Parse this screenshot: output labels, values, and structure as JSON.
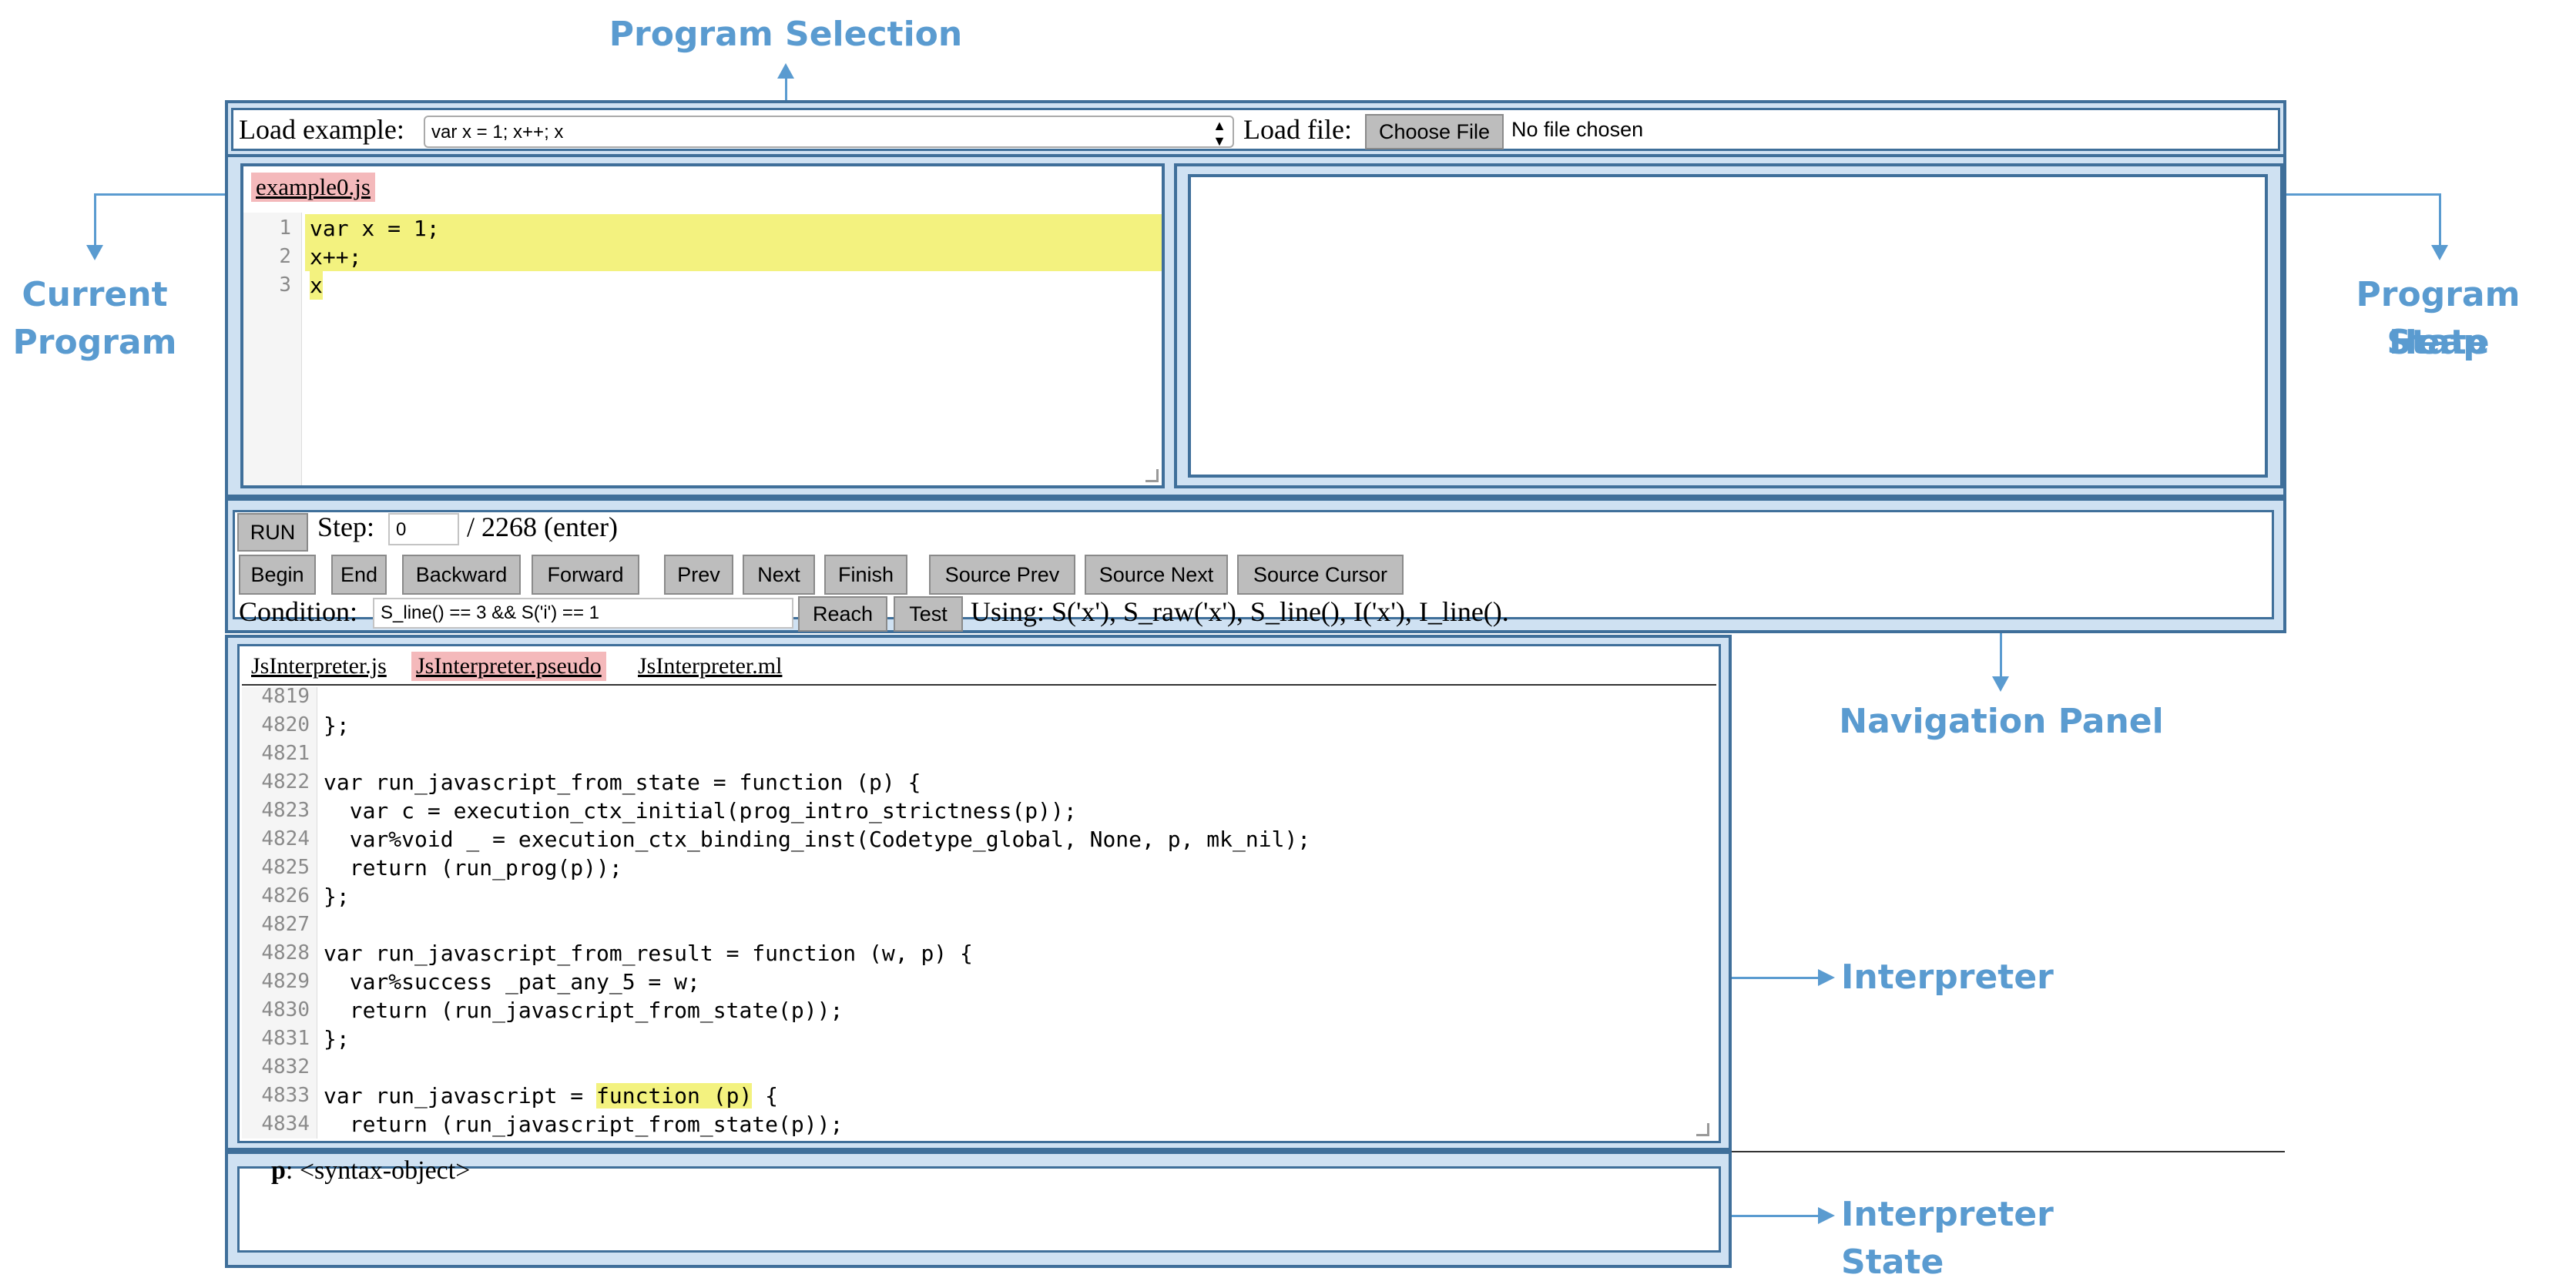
{
  "callouts": {
    "program_selection": "Program Selection",
    "current_program": [
      "Current",
      "Program"
    ],
    "program_heap_state": [
      "Program Heap",
      "State"
    ],
    "navigation_panel": "Navigation Panel",
    "interpreter": "Interpreter",
    "interpreter_state": "Interpreter State"
  },
  "selection": {
    "load_example_label": "Load example:",
    "example_value": "var x = 1; x++; x",
    "load_file_label": "Load file:",
    "choose_file_button": "Choose File",
    "no_file_text": "No file chosen"
  },
  "editor": {
    "tab": "example0.js",
    "lines": [
      {
        "n": "1",
        "text": "var x = 1;"
      },
      {
        "n": "2",
        "text": "x++;"
      },
      {
        "n": "3",
        "text": "x"
      }
    ]
  },
  "navigation": {
    "run_button": "RUN",
    "step_label": "Step:",
    "step_value": "0",
    "step_total": "/ 2268 (enter)",
    "buttons": {
      "begin": "Begin",
      "end": "End",
      "backward": "Backward",
      "forward": "Forward",
      "prev": "Prev",
      "next": "Next",
      "finish": "Finish",
      "source_prev": "Source Prev",
      "source_next": "Source Next",
      "source_cursor": "Source Cursor"
    },
    "condition_label": "Condition:",
    "condition_value": "S_line() == 3 && S('i') == 1",
    "reach_button": "Reach",
    "test_button": "Test",
    "using_text": "Using: S('x'), S_raw('x'), S_line(), I('x'), I_line()."
  },
  "interpreter": {
    "tabs": [
      "JsInterpreter.js",
      "JsInterpreter.pseudo",
      "JsInterpreter.ml"
    ],
    "active_tab": "JsInterpreter.pseudo",
    "lines": [
      {
        "n": "4819",
        "text": ""
      },
      {
        "n": "4820",
        "text": "};"
      },
      {
        "n": "4821",
        "text": ""
      },
      {
        "n": "4822",
        "text": "var run_javascript_from_state = function (p) {"
      },
      {
        "n": "4823",
        "text": "  var c = execution_ctx_initial(prog_intro_strictness(p));"
      },
      {
        "n": "4824",
        "text": "  var%void _ = execution_ctx_binding_inst(Codetype_global, None, p, mk_nil);"
      },
      {
        "n": "4825",
        "text": "  return (run_prog(p));"
      },
      {
        "n": "4826",
        "text": "};"
      },
      {
        "n": "4827",
        "text": ""
      },
      {
        "n": "4828",
        "text": "var run_javascript_from_result = function (w, p) {"
      },
      {
        "n": "4829",
        "text": "  var%success _pat_any_5 = w;"
      },
      {
        "n": "4830",
        "text": "  return (run_javascript_from_state(p));"
      },
      {
        "n": "4831",
        "text": "};"
      },
      {
        "n": "4832",
        "text": ""
      },
      {
        "n": "4833",
        "pre": "var run_javascript = ",
        "hl": "function (p)",
        "post": " {"
      },
      {
        "n": "4834",
        "text": "  return (run_javascript_from_state(p));"
      }
    ]
  },
  "interpreter_state": {
    "var_name": "p",
    "var_value": ": <syntax-object>"
  }
}
